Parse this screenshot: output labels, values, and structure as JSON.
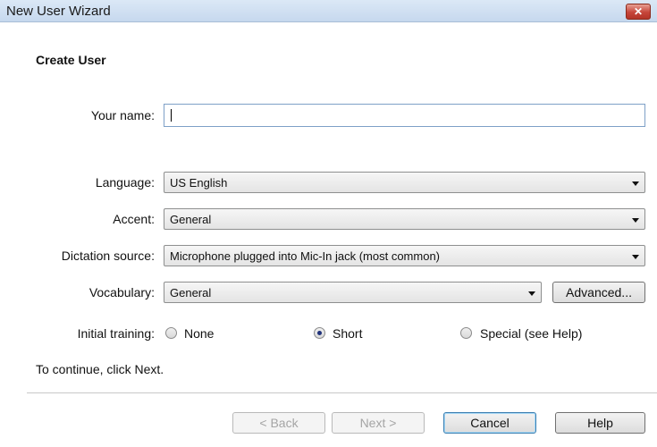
{
  "window": {
    "title": "New User Wizard"
  },
  "page": {
    "heading": "Create User"
  },
  "fields": {
    "name": {
      "label": "Your name:",
      "value": ""
    },
    "language": {
      "label": "Language:",
      "value": "US English"
    },
    "accent": {
      "label": "Accent:",
      "value": "General"
    },
    "dictation": {
      "label": "Dictation source:",
      "value": "Microphone plugged into Mic-In jack (most common)"
    },
    "vocabulary": {
      "label": "Vocabulary:",
      "value": "General",
      "advanced_label": "Advanced..."
    },
    "training": {
      "label": "Initial training:",
      "options": [
        {
          "label": "None",
          "checked": false
        },
        {
          "label": "Short",
          "checked": true
        },
        {
          "label": "Special (see Help)",
          "checked": false
        }
      ]
    }
  },
  "instructions": "To continue, click Next.",
  "buttons": {
    "back": "< Back",
    "next": "Next >",
    "cancel": "Cancel",
    "help": "Help"
  }
}
